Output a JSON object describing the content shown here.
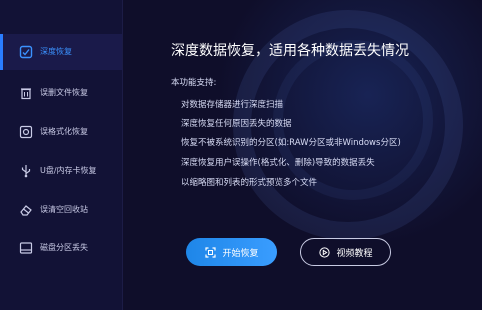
{
  "sidebar": {
    "items": [
      {
        "label": "深度恢复",
        "icon": "scan-icon",
        "active": true
      },
      {
        "label": "误删文件恢复",
        "icon": "trash-icon",
        "active": false
      },
      {
        "label": "误格式化恢复",
        "icon": "format-disk-icon",
        "active": false
      },
      {
        "label": "U盘/内存卡恢复",
        "icon": "usb-icon",
        "active": false
      },
      {
        "label": "误清空回收站",
        "icon": "eraser-icon",
        "active": false
      },
      {
        "label": "磁盘分区丢失",
        "icon": "partition-icon",
        "active": false
      }
    ]
  },
  "main": {
    "title": "深度数据恢复，适用各种数据丢失情况",
    "subtitle": "本功能支持:",
    "features": [
      "对数据存储器进行深度扫描",
      "深度恢复任何原因丢失的数据",
      "恢复不被系统识别的分区(如:RAW分区或非Windows分区)",
      "深度恢复用户误操作(格式化、删除)导致的数据丢失",
      "以缩略图和列表的形式预览多个文件"
    ],
    "start_button": "开始恢复",
    "video_button": "视频教程"
  },
  "colors": {
    "accent": "#2a7dff",
    "background": "#0f0e2a",
    "sidebar": "#121236"
  }
}
